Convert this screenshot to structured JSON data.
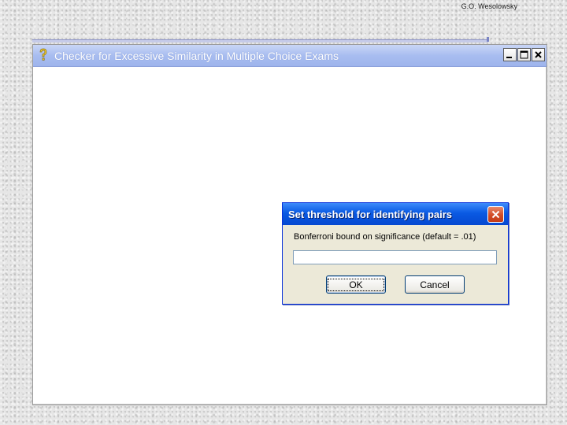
{
  "author": "G.O. Wesolowsky",
  "main_window": {
    "title": "Checker for Excessive Similarity in Multiple Choice Exams",
    "title_icon": "help-icon",
    "controls": [
      "minimize-icon",
      "maximize-icon",
      "close-icon"
    ]
  },
  "dialog": {
    "title": "Set threshold for identifying pairs",
    "prompt": "Bonferroni bound on significance (default = .01)",
    "input_value": "",
    "ok_label": "OK",
    "cancel_label": "Cancel",
    "title_color": "#0a5ae3",
    "close_color": "#d24b25"
  },
  "colors": {
    "main_titlebar": "#a8bdf0",
    "dialog_face": "#ece9d8"
  }
}
